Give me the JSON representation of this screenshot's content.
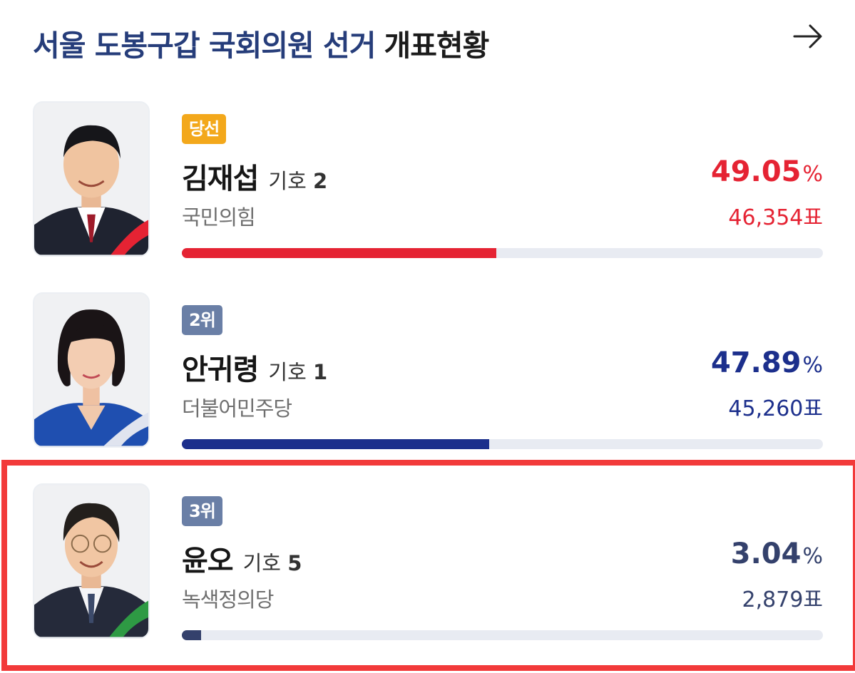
{
  "header": {
    "title_main": "서울 도봉구갑 국회의원 선거",
    "title_suffix": "개표현황"
  },
  "candidates": [
    {
      "badge": "당선",
      "name": "김재섭",
      "number_label": "기호",
      "number": "2",
      "party": "국민의힘",
      "percent": "49.05",
      "percent_unit": "%",
      "votes": "46,354표",
      "share": 0.4905,
      "badge_color": "#f3a81b",
      "color": "#e52333"
    },
    {
      "badge": "2위",
      "name": "안귀령",
      "number_label": "기호",
      "number": "1",
      "party": "더불어민주당",
      "percent": "47.89",
      "percent_unit": "%",
      "votes": "45,260표",
      "share": 0.4789,
      "badge_color": "#6a7fa6",
      "color": "#1c2f8c"
    },
    {
      "badge": "3위",
      "name": "윤오",
      "number_label": "기호",
      "number": "5",
      "party": "녹색정의당",
      "percent": "3.04",
      "percent_unit": "%",
      "votes": "2,879표",
      "share": 0.0304,
      "badge_color": "#6a7fa6",
      "color": "#34416c"
    }
  ],
  "colors": {
    "title_blue": "#263d7a",
    "highlight_red": "#f23a3a"
  }
}
